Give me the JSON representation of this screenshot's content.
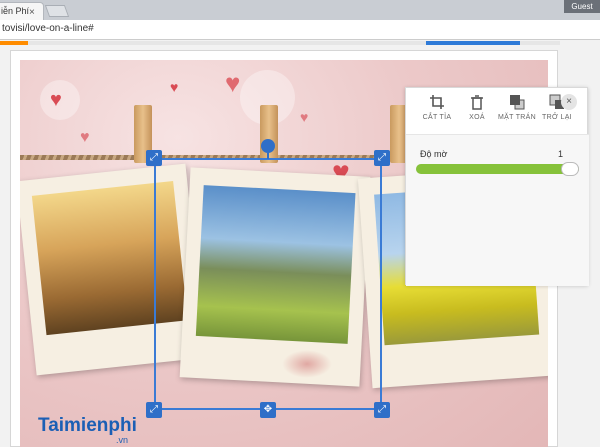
{
  "browser": {
    "tab_title": "iễn Phí",
    "tab_close": "×",
    "profile": "Guest",
    "url": "tovisi/love-on-a-line#"
  },
  "editor": {
    "selection": {
      "rotate_handle": "rotate-handle",
      "move_icon": "✥",
      "resize_icon": "⤢"
    },
    "logo": {
      "name": "Taimienphi",
      "suffix": ".vn"
    }
  },
  "panel": {
    "tools": [
      {
        "label": "CẮT TỈA",
        "icon": "crop-icon"
      },
      {
        "label": "XOÁ",
        "icon": "trash-icon"
      },
      {
        "label": "MẶT TRÁN",
        "icon": "layer-front-icon"
      },
      {
        "label": "TRỞ LẠI",
        "icon": "layer-back-icon"
      }
    ],
    "close": "×",
    "opacity_label": "Độ mờ",
    "opacity_value": "1",
    "opacity_fraction": 1.0
  },
  "colors": {
    "accent": "#2f6fc8",
    "slider": "#86c23a",
    "tab_orange": "#ff8c00"
  }
}
